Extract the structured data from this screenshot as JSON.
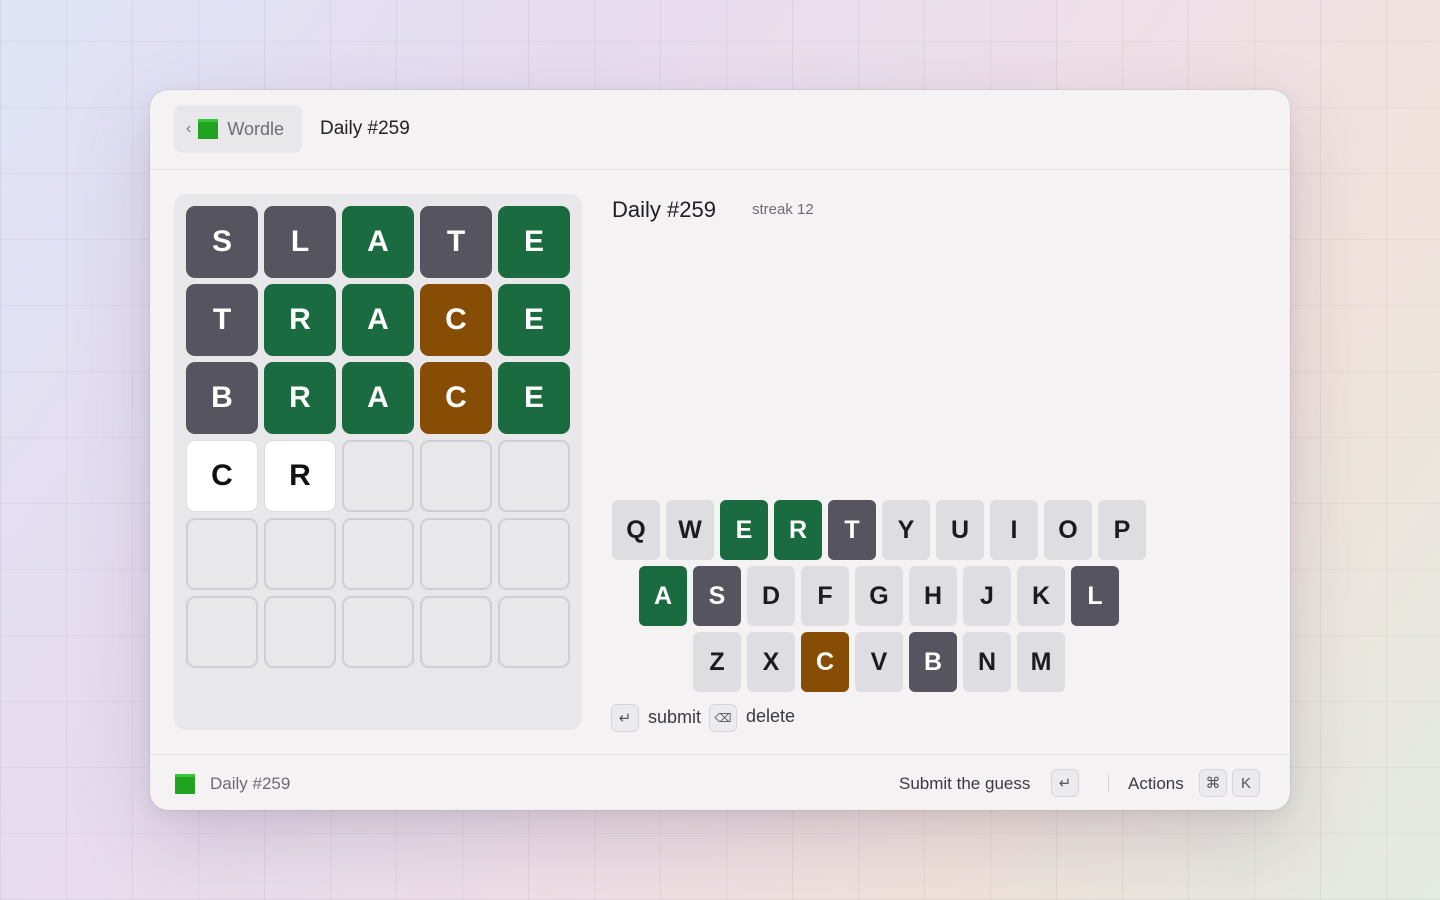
{
  "header": {
    "back_label": "Wordle",
    "back_chevron": "‹",
    "title": "Daily #259"
  },
  "info": {
    "title": "Daily #259",
    "streak": "streak 12"
  },
  "board": {
    "rows": [
      [
        {
          "l": "S",
          "s": "absent"
        },
        {
          "l": "L",
          "s": "absent"
        },
        {
          "l": "A",
          "s": "correct"
        },
        {
          "l": "T",
          "s": "absent"
        },
        {
          "l": "E",
          "s": "correct"
        }
      ],
      [
        {
          "l": "T",
          "s": "absent"
        },
        {
          "l": "R",
          "s": "correct"
        },
        {
          "l": "A",
          "s": "correct"
        },
        {
          "l": "C",
          "s": "present"
        },
        {
          "l": "E",
          "s": "correct"
        }
      ],
      [
        {
          "l": "B",
          "s": "absent"
        },
        {
          "l": "R",
          "s": "correct"
        },
        {
          "l": "A",
          "s": "correct"
        },
        {
          "l": "C",
          "s": "present"
        },
        {
          "l": "E",
          "s": "correct"
        }
      ],
      [
        {
          "l": "C",
          "s": "typed"
        },
        {
          "l": "R",
          "s": "typed"
        },
        {
          "l": "",
          "s": "empty"
        },
        {
          "l": "",
          "s": "empty"
        },
        {
          "l": "",
          "s": "empty"
        }
      ],
      [
        {
          "l": "",
          "s": "empty"
        },
        {
          "l": "",
          "s": "empty"
        },
        {
          "l": "",
          "s": "empty"
        },
        {
          "l": "",
          "s": "empty"
        },
        {
          "l": "",
          "s": "empty"
        }
      ],
      [
        {
          "l": "",
          "s": "empty"
        },
        {
          "l": "",
          "s": "empty"
        },
        {
          "l": "",
          "s": "empty"
        },
        {
          "l": "",
          "s": "empty"
        },
        {
          "l": "",
          "s": "empty"
        }
      ]
    ]
  },
  "keyboard": {
    "rows": [
      [
        {
          "k": "Q",
          "s": "unused"
        },
        {
          "k": "W",
          "s": "unused"
        },
        {
          "k": "E",
          "s": "correct"
        },
        {
          "k": "R",
          "s": "correct"
        },
        {
          "k": "T",
          "s": "absent"
        },
        {
          "k": "Y",
          "s": "unused"
        },
        {
          "k": "U",
          "s": "unused"
        },
        {
          "k": "I",
          "s": "unused"
        },
        {
          "k": "O",
          "s": "unused"
        },
        {
          "k": "P",
          "s": "unused"
        }
      ],
      [
        {
          "k": "A",
          "s": "correct"
        },
        {
          "k": "S",
          "s": "absent"
        },
        {
          "k": "D",
          "s": "unused"
        },
        {
          "k": "F",
          "s": "unused"
        },
        {
          "k": "G",
          "s": "unused"
        },
        {
          "k": "H",
          "s": "unused"
        },
        {
          "k": "J",
          "s": "unused"
        },
        {
          "k": "K",
          "s": "unused"
        },
        {
          "k": "L",
          "s": "absent"
        }
      ],
      [
        {
          "k": "Z",
          "s": "unused"
        },
        {
          "k": "X",
          "s": "unused"
        },
        {
          "k": "C",
          "s": "present"
        },
        {
          "k": "V",
          "s": "unused"
        },
        {
          "k": "B",
          "s": "absent"
        },
        {
          "k": "N",
          "s": "unused"
        },
        {
          "k": "M",
          "s": "unused"
        }
      ]
    ]
  },
  "hints": {
    "submit_key": "↵",
    "submit_label": "submit",
    "delete_key": "⌫",
    "delete_label": "delete"
  },
  "footer": {
    "title": "Daily #259",
    "primary_action": "Submit the guess",
    "primary_key": "↵",
    "actions_label": "Actions",
    "actions_key_1": "⌘",
    "actions_key_2": "K"
  },
  "colors": {
    "correct": "#1a6b3f",
    "present": "#884d05",
    "absent": "#56555f",
    "brand": "#21a321"
  },
  "icons": {
    "back": "chevron-left-icon",
    "brand": "green-square-icon",
    "enter": "return-icon",
    "delete": "backspace-icon",
    "command": "command-icon"
  }
}
